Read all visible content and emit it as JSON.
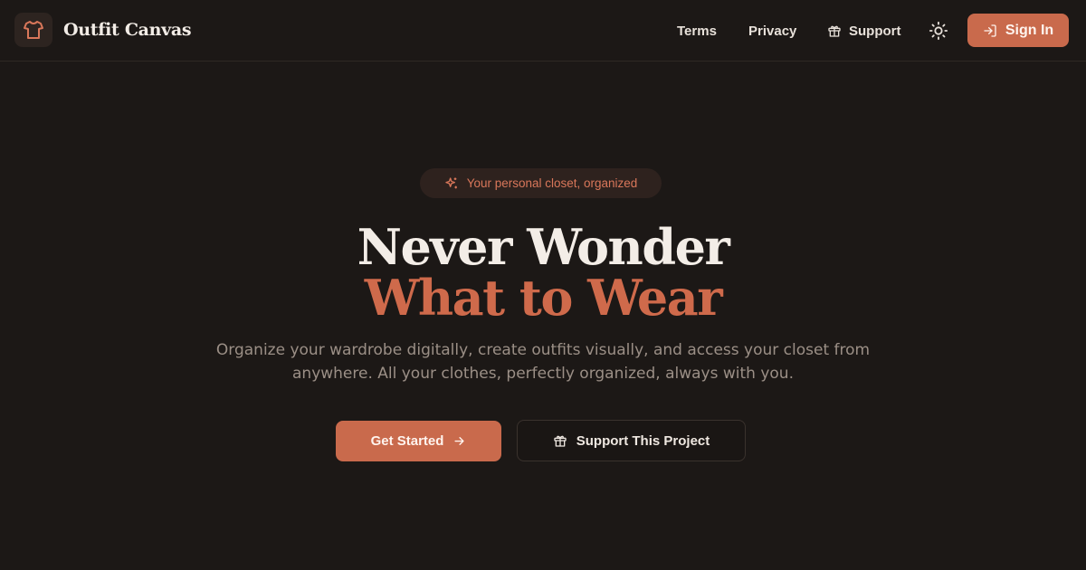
{
  "brand": {
    "name": "Outfit Canvas",
    "icon": "shirt-icon"
  },
  "nav": {
    "terms": "Terms",
    "privacy": "Privacy",
    "support": "Support",
    "theme_icon": "sun-icon",
    "signin": "Sign In"
  },
  "hero": {
    "badge": "Your personal closet, organized",
    "headline_line1": "Never Wonder",
    "headline_line2": "What to Wear",
    "subtitle": "Organize your wardrobe digitally, create outfits visually, and access your closet from anywhere. All your clothes, perfectly organized, always with you.",
    "cta_primary": "Get Started",
    "cta_secondary": "Support This Project"
  },
  "colors": {
    "background": "#1c1816",
    "accent": "#c96a4c",
    "headline": "#f3ede7",
    "muted_text": "#9b8f86"
  }
}
